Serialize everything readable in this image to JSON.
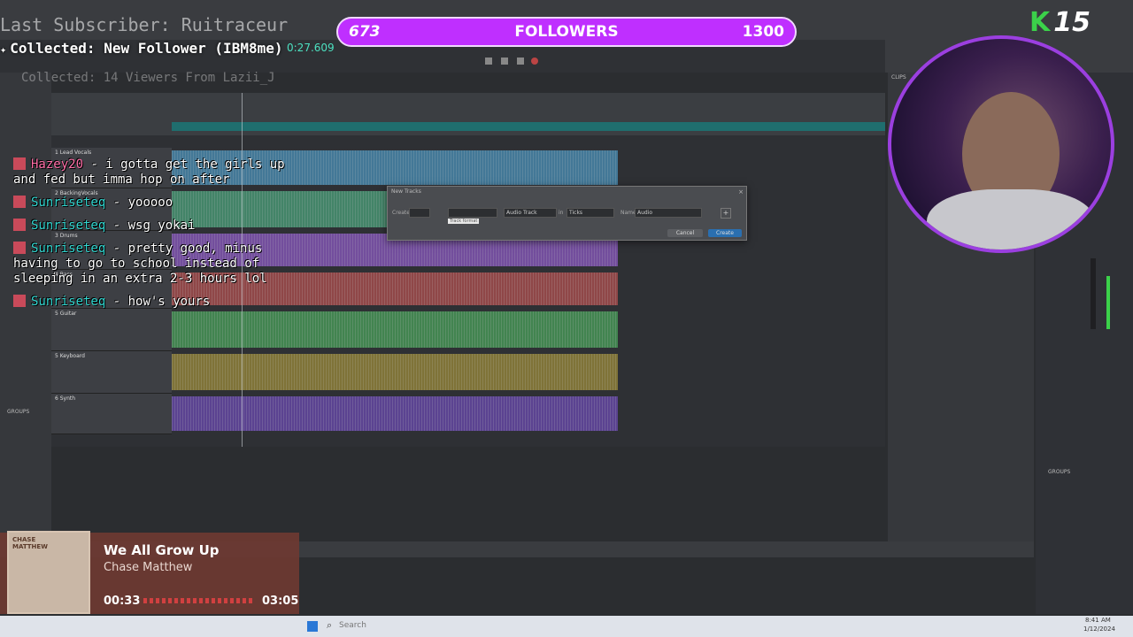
{
  "overlay": {
    "last_subscriber": "Last Subscriber: Ruitraceur",
    "collected_primary": "Collected: New Follower (IBM8me)",
    "collected_secondary": "Collected: 14 Viewers From Lazii_J",
    "followers": {
      "count": "673",
      "label": "FOLLOWERS",
      "goal": "1300",
      "progress_fraction": 0.52
    },
    "badge": {
      "letter": "K",
      "number": "15"
    }
  },
  "daw": {
    "timer": "0:27.609",
    "tracks": [
      {
        "name": "1 Lead Vocals",
        "color": "#4a90b8"
      },
      {
        "name": "2 BackingVocals",
        "color": "#4aa07a"
      },
      {
        "name": "3 Drums",
        "color": "#8a58c0"
      },
      {
        "name": "4 Bass",
        "color": "#b04f4f"
      },
      {
        "name": "5 Guitar",
        "color": "#49a05a"
      },
      {
        "name": "5 Keyboard",
        "color": "#9a8a3a"
      },
      {
        "name": "6 Synth",
        "color": "#6a4ab0"
      }
    ],
    "dialog": {
      "title": "New Tracks",
      "create_label": "Create",
      "type_value": "Audio Track",
      "in_label": "in",
      "in_value": "Ticks",
      "name_label": "Name",
      "name_value": "Audio",
      "cancel_button": "Cancel",
      "create_button": "Create",
      "tooltip": "Track format"
    }
  },
  "chat": [
    {
      "user": "Hazey20",
      "message": "- i gotta get the girls up and fed but imma hop on after",
      "pink": true
    },
    {
      "user": "Sunriseteq",
      "message": "- yooooo",
      "pink": false
    },
    {
      "user": "Sunriseteq",
      "message": "- wsg yokai",
      "pink": false
    },
    {
      "user": "Sunriseteq",
      "message": "- pretty good, minus having to go to school instead of sleeping in an extra 2-3 hours lol",
      "pink": false
    },
    {
      "user": "Sunriseteq",
      "message": "- how's yours",
      "pink": false
    }
  ],
  "music": {
    "title": "We All Grow Up",
    "artist": "Chase Matthew",
    "elapsed": "00:33",
    "duration": "03:05",
    "progress_fraction": 0.18,
    "album_text": "CHASE MATTHEW"
  },
  "taskbar": {
    "search_placeholder": "Search",
    "date": "1/12/2024",
    "clock": "8:41 AM"
  },
  "colors": {
    "accent": "#bf2fff",
    "chat_name": "#32d6d0",
    "music_bg": "#6e3a32"
  }
}
